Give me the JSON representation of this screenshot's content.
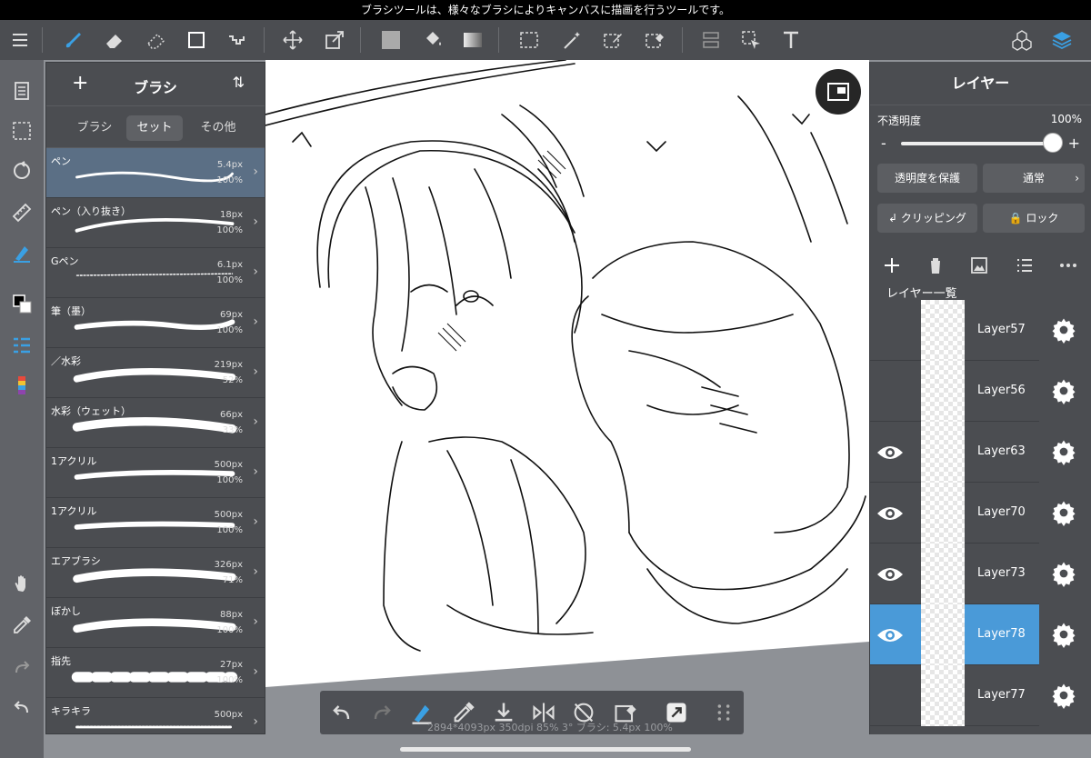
{
  "status_bar": {
    "tooltip": "ブラシツールは、様々なブラシによりキャンバスに描画を行うツールです。"
  },
  "toolbar": {
    "tools": [
      "menu-icon",
      "brush-icon",
      "eraser-icon",
      "lasso-eraser-icon",
      "shape-icon",
      "dot-icon",
      "move-icon",
      "transform-icon",
      "fill-color-icon",
      "bucket-icon",
      "gradient-icon",
      "select-icon",
      "magic-wand-icon",
      "select-pen-icon",
      "select-eraser-icon",
      "snap-icon",
      "select-move-icon",
      "text-icon",
      "material-icon",
      "layer-icon"
    ],
    "accent": "#3aa0e4"
  },
  "brush_panel": {
    "title": "ブラシ",
    "add": "+",
    "sort": "⇅",
    "tabs": [
      {
        "label": "ブラシ"
      },
      {
        "label": "セット"
      },
      {
        "label": "その他"
      }
    ],
    "brushes": [
      {
        "name": "ペン",
        "size": "5.4px",
        "opacity": "100%",
        "active": true
      },
      {
        "name": "ペン（入り抜き）",
        "size": "18px",
        "opacity": "100%"
      },
      {
        "name": "Gペン",
        "size": "6.1px",
        "opacity": "100%"
      },
      {
        "name": "筆（墨）",
        "size": "69px",
        "opacity": "100%"
      },
      {
        "name": "／水彩",
        "size": "219px",
        "opacity": "52%"
      },
      {
        "name": "水彩（ウェット）",
        "size": "66px",
        "opacity": "33%"
      },
      {
        "name": "1アクリル",
        "size": "500px",
        "opacity": "100%"
      },
      {
        "name": "1アクリル",
        "size": "500px",
        "opacity": "100%"
      },
      {
        "name": "エアブラシ",
        "size": "326px",
        "opacity": "71%"
      },
      {
        "name": "ぼかし",
        "size": "88px",
        "opacity": "100%"
      },
      {
        "name": "指先",
        "size": "27px",
        "opacity": "100%"
      },
      {
        "name": "キラキラ",
        "size": "500px",
        "opacity": ""
      }
    ]
  },
  "layer_panel": {
    "title": "レイヤー",
    "opacity_label": "不透明度",
    "opacity_value": "100%",
    "opacity_fraction": 1.0,
    "minus": "-",
    "plus": "+",
    "protect_alpha": "透明度を保護",
    "blend_mode": "通常",
    "clipping": "クリッピング",
    "lock": "ロック",
    "list_label": "レイヤー一覧",
    "layers": [
      {
        "name": "Layer57",
        "visible": false
      },
      {
        "name": "Layer56",
        "visible": false
      },
      {
        "name": "Layer63",
        "visible": true
      },
      {
        "name": "Layer70",
        "visible": true
      },
      {
        "name": "Layer73",
        "visible": true
      },
      {
        "name": "Layer78",
        "visible": true,
        "active": true
      },
      {
        "name": "Layer77",
        "visible": false
      }
    ]
  },
  "bottom_bar": {
    "info": "2894*4093px 350dpi 85% 3° ブラシ: 5.4px 100%"
  }
}
